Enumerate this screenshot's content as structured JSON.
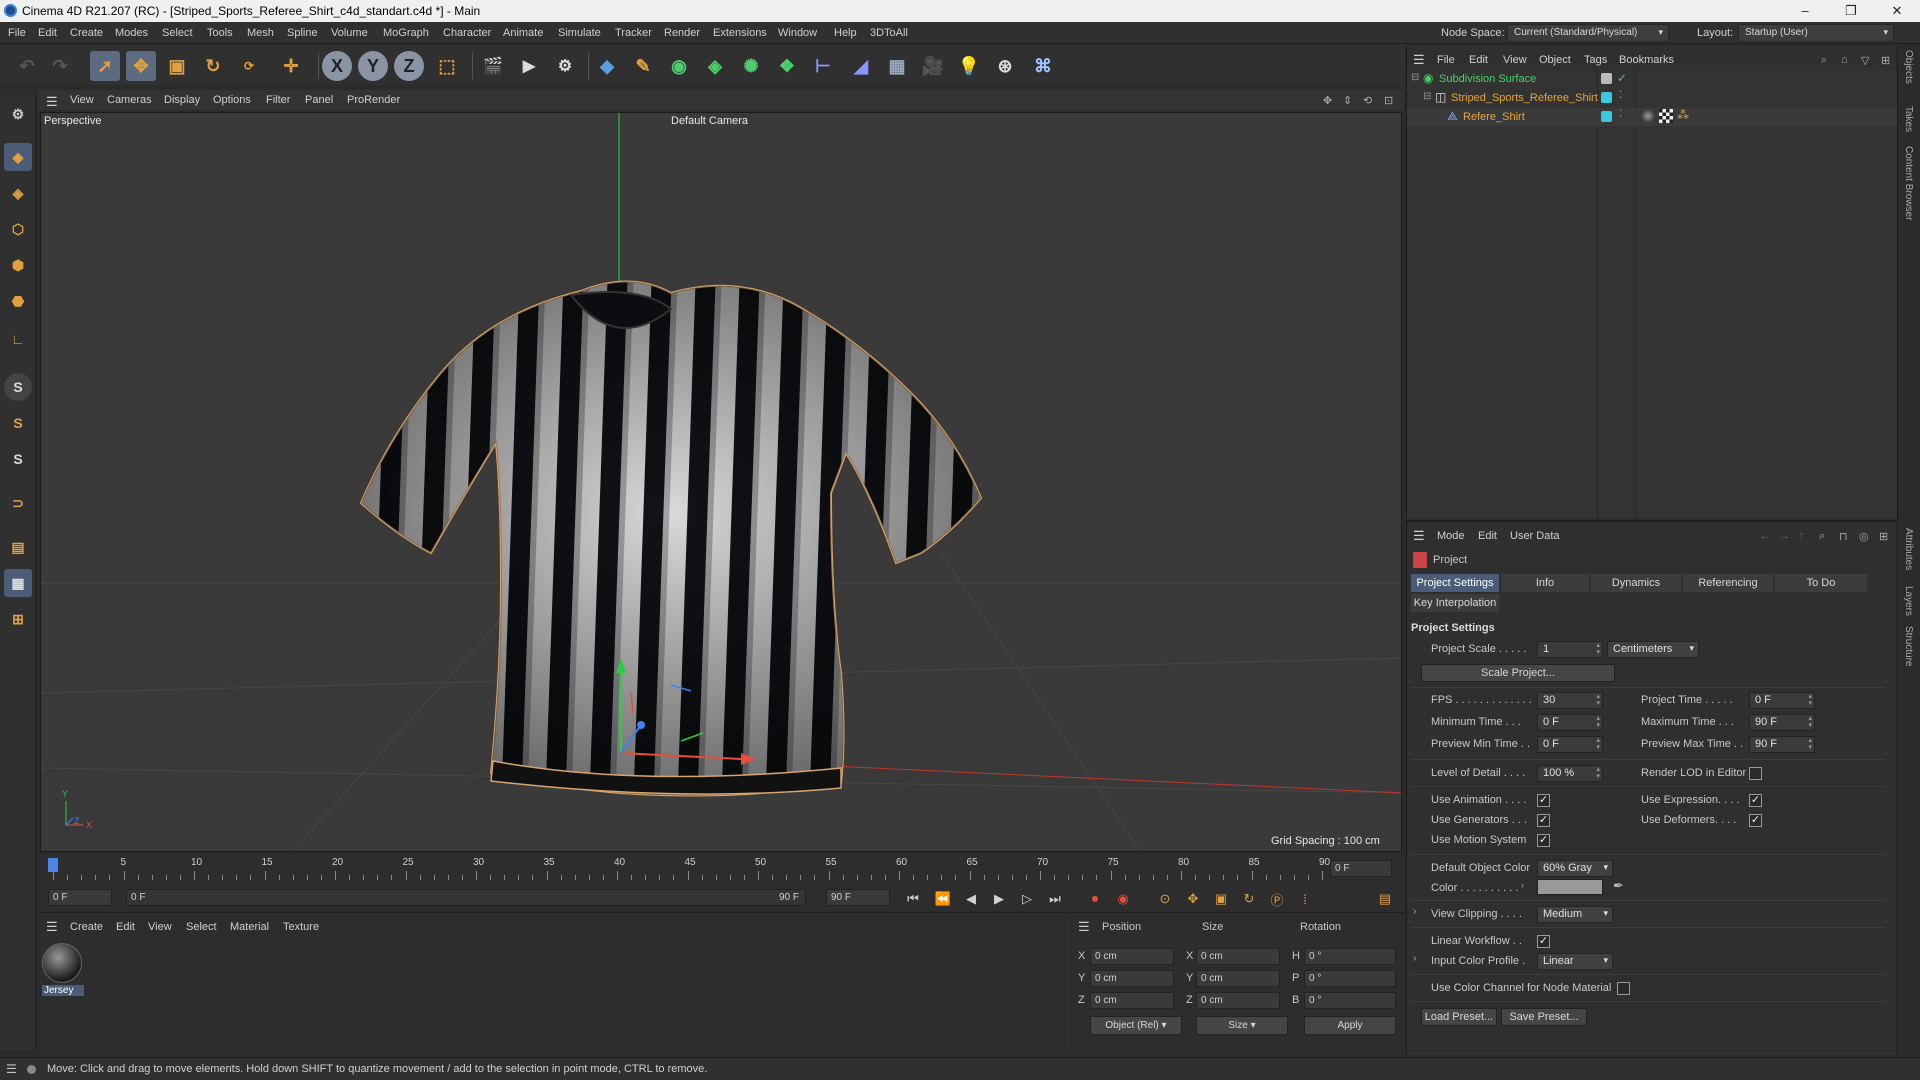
{
  "window": {
    "title": "Cinema 4D R21.207 (RC) - [Striped_Sports_Referee_Shirt_c4d_standart.c4d *] - Main",
    "minimize": "–",
    "maximize": "❐",
    "close": "✕"
  },
  "menubar": {
    "items": [
      "File",
      "Edit",
      "Create",
      "Modes",
      "Select",
      "Tools",
      "Mesh",
      "Spline",
      "Volume",
      "MoGraph",
      "Character",
      "Animate",
      "Simulate",
      "Tracker",
      "Render",
      "Extensions",
      "Window",
      "Help",
      "3DToAll"
    ],
    "node_space_label": "Node Space:",
    "node_space_value": "Current (Standard/Physical)",
    "layout_label": "Layout:",
    "layout_value": "Startup (User)"
  },
  "viewport": {
    "menu": [
      "View",
      "Cameras",
      "Display",
      "Options",
      "Filter",
      "Panel",
      "ProRender"
    ],
    "view_name": "Perspective",
    "camera_label": "Default Camera",
    "grid_spacing": "Grid Spacing : 100 cm",
    "axis_y": "Y",
    "axis_z": "Z",
    "axis_x": "X"
  },
  "timeline": {
    "ticks": [
      "0",
      "5",
      "10",
      "15",
      "20",
      "25",
      "30",
      "35",
      "40",
      "45",
      "50",
      "55",
      "60",
      "65",
      "70",
      "75",
      "80",
      "85",
      "90"
    ],
    "current_frame_field": "0 F",
    "start_field": "0 F",
    "range_start": "0 F",
    "range_end": "90 F",
    "end_field": "90 F"
  },
  "material_manager": {
    "menu": [
      "Create",
      "Edit",
      "View",
      "Select",
      "Material",
      "Texture"
    ],
    "materials": [
      {
        "name": "Jersey"
      }
    ]
  },
  "coordinates": {
    "headers": {
      "position": "Position",
      "size": "Size",
      "rotation": "Rotation"
    },
    "rows": [
      {
        "axis": "X",
        "pos": "0 cm",
        "size_axis": "X",
        "size": "0 cm",
        "rot_axis": "H",
        "rot": "0 °"
      },
      {
        "axis": "Y",
        "pos": "0 cm",
        "size_axis": "Y",
        "size": "0 cm",
        "rot_axis": "P",
        "rot": "0 °"
      },
      {
        "axis": "Z",
        "pos": "0 cm",
        "size_axis": "Z",
        "size": "0 cm",
        "rot_axis": "B",
        "rot": "0 °"
      }
    ],
    "mode_select": "Object (Rel)",
    "size_select": "Size",
    "apply": "Apply"
  },
  "status": {
    "text": "Move: Click and drag to move elements. Hold down SHIFT to quantize movement / add to the selection in point mode, CTRL to remove."
  },
  "object_manager": {
    "menu": [
      "File",
      "Edit",
      "View",
      "Object",
      "Tags",
      "Bookmarks"
    ],
    "objects": [
      {
        "name": "Subdivision Surface"
      },
      {
        "name": "Striped_Sports_Referee_Shirt"
      },
      {
        "name": "Refere_Shirt"
      }
    ]
  },
  "side_tabs": {
    "top": [
      "Objects",
      "Takes",
      "Content Browser"
    ],
    "bottom": [
      "Attributes",
      "Layers",
      "Structure"
    ]
  },
  "attributes": {
    "menu": [
      "Mode",
      "Edit",
      "User Data"
    ],
    "object_label": "Project",
    "tabs": [
      "Project Settings",
      "Info",
      "Dynamics",
      "Referencing",
      "To Do"
    ],
    "tab_key_interp": "Key Interpolation",
    "section_title": "Project Settings",
    "project_scale_label": "Project Scale . . . . .",
    "project_scale_value": "1",
    "project_scale_unit": "Centimeters",
    "scale_project_btn": "Scale Project...",
    "fps_label": "FPS . . . . . . . . . . . . .",
    "fps_value": "30",
    "project_time_label": "Project Time . . . . .",
    "project_time_value": "0 F",
    "min_time_label": "Minimum Time . . .",
    "min_time_value": "0 F",
    "max_time_label": "Maximum Time . . .",
    "max_time_value": "90 F",
    "prev_min_label": "Preview Min Time . .",
    "prev_min_value": "0 F",
    "prev_max_label": "Preview Max Time . .",
    "prev_max_value": "90 F",
    "lod_label": "Level of Detail . . . .",
    "lod_value": "100 %",
    "render_lod_label": "Render LOD in Editor",
    "use_animation_label": "Use Animation . . . .",
    "use_expression_label": "Use Expression. . . .",
    "use_generators_label": "Use Generators . . .",
    "use_deformers_label": "Use Deformers. . . .",
    "use_motion_label": "Use Motion System",
    "default_color_label": "Default Object Color",
    "default_color_value": "60% Gray",
    "color_label": "Color . . . . . . . . . .",
    "view_clipping_label": "View Clipping . . . .",
    "view_clipping_value": "Medium",
    "linear_workflow_label": "Linear Workflow . .",
    "input_color_label": "Input Color Profile .",
    "input_color_value": "Linear",
    "use_color_channel_label": "Use Color Channel for Node Material",
    "load_preset": "Load Preset...",
    "save_preset": "Save Preset...",
    "checkmark": "✓"
  },
  "colors": {
    "accent_blue": "#4a5c78",
    "object_orange": "#e8a43a",
    "axis_green": "#3cc33c",
    "axis_red": "#d63a3a",
    "axis_blue": "#4a8cf0"
  }
}
